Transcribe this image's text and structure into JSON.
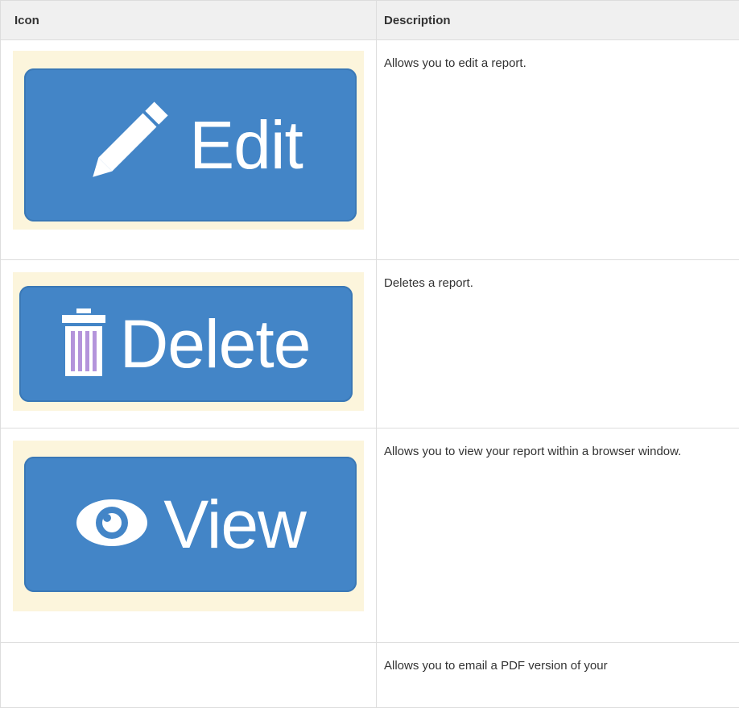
{
  "table": {
    "headers": {
      "icon": "Icon",
      "description": "Description"
    },
    "rows": [
      {
        "button_label": "Edit",
        "icon_name": "pencil-icon",
        "description": "Allows you to edit a report."
      },
      {
        "button_label": "Delete",
        "icon_name": "trash-icon",
        "description": "Deletes a report."
      },
      {
        "button_label": "View",
        "icon_name": "eye-icon",
        "description": "Allows you to view your report within a browser window."
      },
      {
        "button_label": "",
        "icon_name": "",
        "description": "Allows you to email a PDF version of your"
      }
    ]
  },
  "colors": {
    "button_blue": "#4385c7",
    "frame_cream": "#fcf5dc",
    "header_bg": "#f0f0f0",
    "border": "#dddddd"
  }
}
